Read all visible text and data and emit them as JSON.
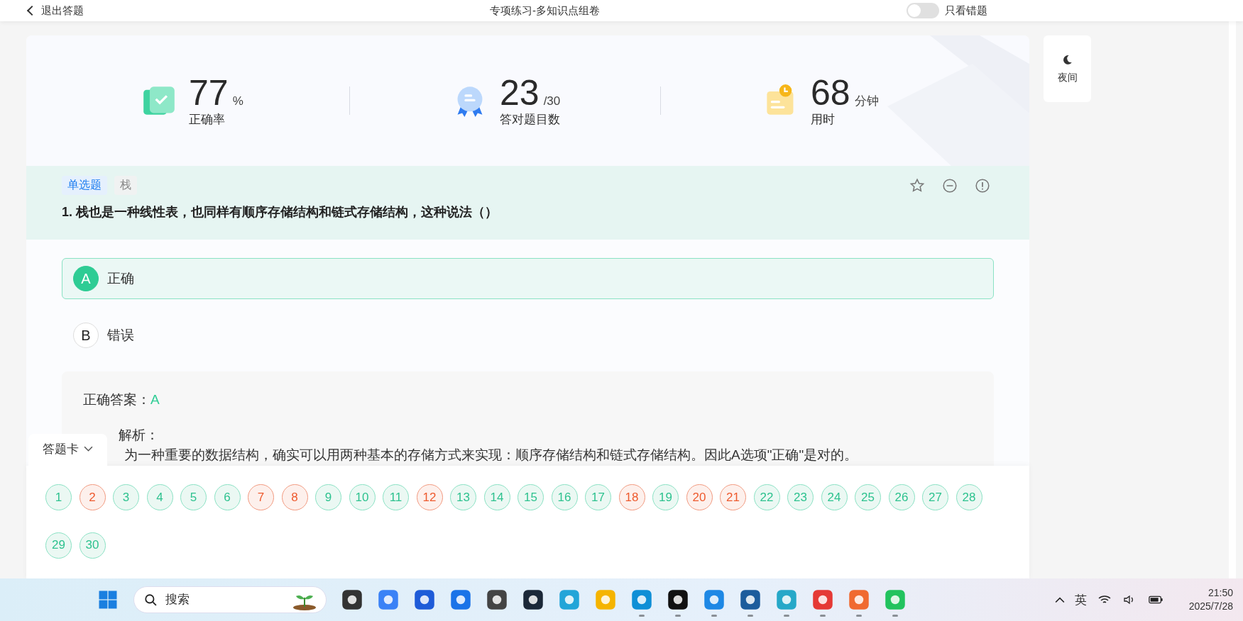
{
  "top_bar": {
    "exit": "退出答题",
    "title": "专项练习-多知识点组卷",
    "wrong_only": {
      "label": "只看错题",
      "on": false
    }
  },
  "stats": [
    {
      "kind": "accuracy",
      "value": "77",
      "unit": "%",
      "label": "正确率"
    },
    {
      "kind": "correct",
      "value": "23",
      "unit": "/30",
      "label": "答对题目数"
    },
    {
      "kind": "time",
      "value": "68",
      "unit": "分钟",
      "label": "用时"
    }
  ],
  "night_button": {
    "label": "夜间"
  },
  "question": {
    "tags": [
      {
        "kind": "type",
        "text": "单选题"
      },
      {
        "kind": "topic",
        "text": "栈"
      }
    ],
    "text": "1. 栈也是一种线性表，也同样有顺序存储结构和链式存储结构，这种说法（）",
    "options": [
      {
        "letter": "A",
        "text": "正确",
        "selected": true
      },
      {
        "letter": "B",
        "text": "错误",
        "selected": false
      }
    ]
  },
  "answer": {
    "label": "正确答案：",
    "value": "A",
    "analysis_label": "解析：",
    "analysis": "为一种重要的数据结构，确实可以用两种基本的存储方式来实现：顺序存储结构和链式存储结构。因此A选项\"正确\"是对的。"
  },
  "answer_card": {
    "tab": "答题卡",
    "items": [
      {
        "number": "1",
        "correct": true
      },
      {
        "number": "2",
        "correct": false
      },
      {
        "number": "3",
        "correct": true
      },
      {
        "number": "4",
        "correct": true
      },
      {
        "number": "5",
        "correct": true
      },
      {
        "number": "6",
        "correct": true
      },
      {
        "number": "7",
        "correct": false
      },
      {
        "number": "8",
        "correct": false
      },
      {
        "number": "9",
        "correct": true
      },
      {
        "number": "10",
        "correct": true
      },
      {
        "number": "11",
        "correct": true
      },
      {
        "number": "12",
        "correct": false
      },
      {
        "number": "13",
        "correct": true
      },
      {
        "number": "14",
        "correct": true
      },
      {
        "number": "15",
        "correct": true
      },
      {
        "number": "16",
        "correct": true
      },
      {
        "number": "17",
        "correct": true
      },
      {
        "number": "18",
        "correct": false
      },
      {
        "number": "19",
        "correct": true
      },
      {
        "number": "20",
        "correct": false
      },
      {
        "number": "21",
        "correct": false
      },
      {
        "number": "22",
        "correct": true
      },
      {
        "number": "23",
        "correct": true
      },
      {
        "number": "24",
        "correct": true
      },
      {
        "number": "25",
        "correct": true
      },
      {
        "number": "26",
        "correct": true
      },
      {
        "number": "27",
        "correct": true
      },
      {
        "number": "28",
        "correct": true
      },
      {
        "number": "29",
        "correct": true
      },
      {
        "number": "30",
        "correct": true
      }
    ]
  },
  "taskbar": {
    "search_placeholder": "搜索",
    "apps": [
      {
        "color": "#333333",
        "open": false
      },
      {
        "color": "#3b82f6",
        "open": false
      },
      {
        "color": "#1e5bd8",
        "open": false
      },
      {
        "color": "#1a73e8",
        "open": false
      },
      {
        "color": "#444444",
        "open": false
      },
      {
        "color": "#1b2838",
        "open": false
      },
      {
        "color": "#22a5d8",
        "open": false
      },
      {
        "color": "#f5b400",
        "open": false
      },
      {
        "color": "#0f8fd6",
        "open": true
      },
      {
        "color": "#111111",
        "open": true
      },
      {
        "color": "#1e88e5",
        "open": true
      },
      {
        "color": "#1c5c9c",
        "open": true
      },
      {
        "color": "#26a8c8",
        "open": true
      },
      {
        "color": "#e53935",
        "open": true
      },
      {
        "color": "#f06a30",
        "open": true
      },
      {
        "color": "#22c35e",
        "open": true
      }
    ],
    "language": "英",
    "time": "21:50",
    "date": "2025/7/28"
  }
}
